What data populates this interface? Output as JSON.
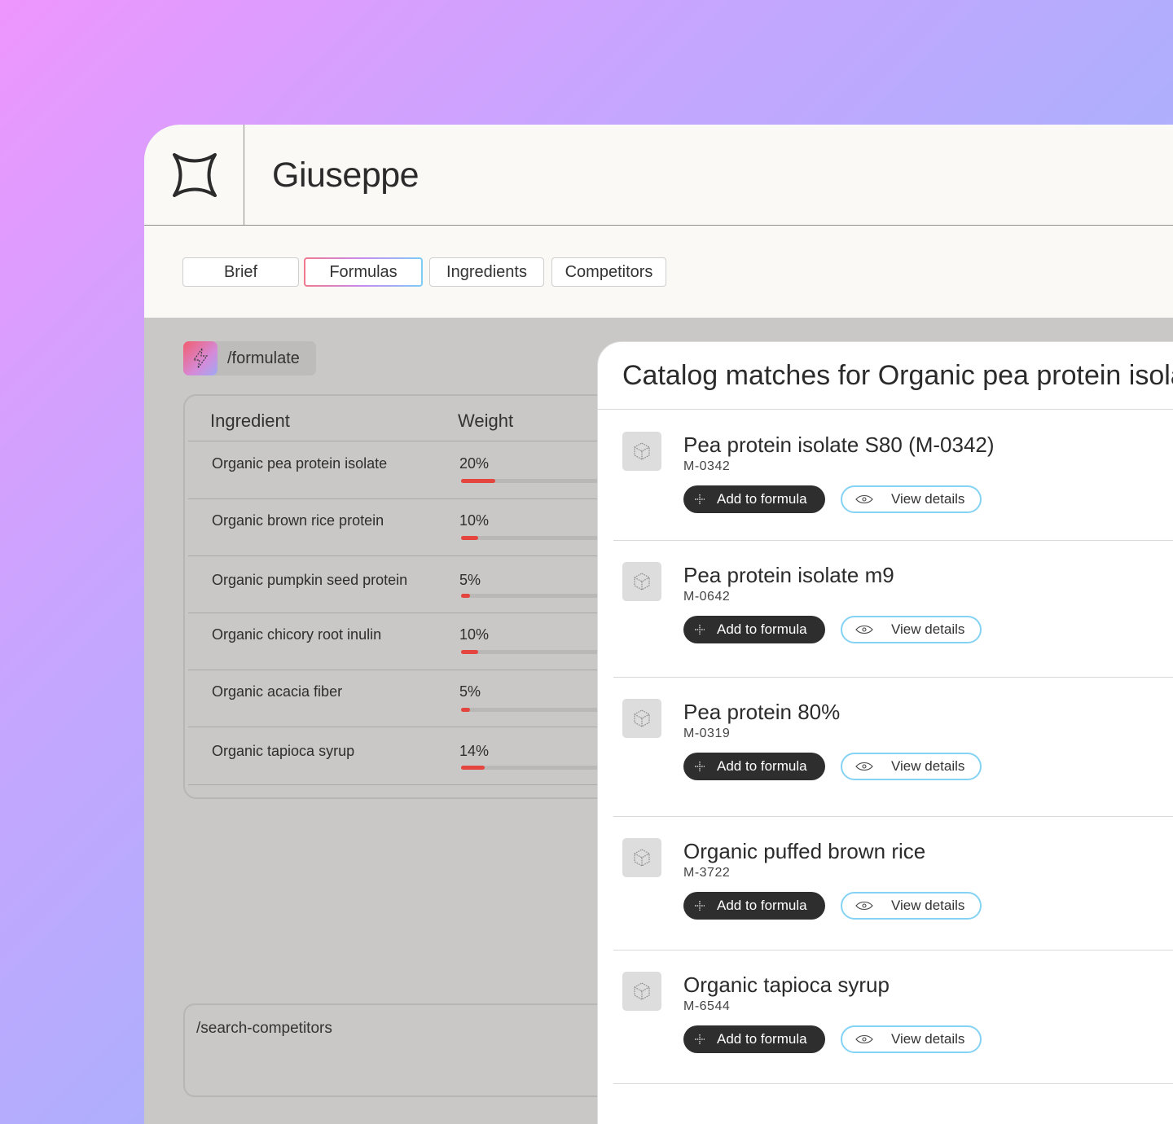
{
  "app": {
    "title": "Giuseppe"
  },
  "tabs": [
    {
      "label": "Brief",
      "active": false
    },
    {
      "label": "Formulas",
      "active": true
    },
    {
      "label": "Ingredients",
      "active": false
    },
    {
      "label": "Competitors",
      "active": false
    }
  ],
  "command": {
    "label": "/formulate",
    "icon": "lightning-icon"
  },
  "table": {
    "headers": {
      "ingredient": "Ingredient",
      "weight": "Weight"
    },
    "rows": [
      {
        "ingredient": "Organic pea protein isolate",
        "weight": "20%",
        "level": 20
      },
      {
        "ingredient": "Organic brown rice protein",
        "weight": "10%",
        "level": 10
      },
      {
        "ingredient": "Organic pumpkin seed protein",
        "weight": "5%",
        "level": 5
      },
      {
        "ingredient": "Organic chicory root inulin",
        "weight": "10%",
        "level": 10
      },
      {
        "ingredient": "Organic acacia fiber",
        "weight": "5%",
        "level": 5
      },
      {
        "ingredient": "Organic tapioca syrup",
        "weight": "14%",
        "level": 14
      }
    ]
  },
  "search": {
    "text": "/search-competitors"
  },
  "panel": {
    "title": "Catalog matches for Organic pea protein isolate",
    "add_label": "Add to formula",
    "view_label": "View details",
    "matches": [
      {
        "name": "Pea protein isolate S80  (M-0342)",
        "code": "M-0342"
      },
      {
        "name": "Pea protein isolate m9",
        "code": "M-0642"
      },
      {
        "name": "Pea protein 80%",
        "code": "M-0319"
      },
      {
        "name": "Organic puffed brown rice",
        "code": "M-3722"
      },
      {
        "name": "Organic tapioca syrup",
        "code": "M-6544"
      }
    ]
  },
  "colors": {
    "accent_red": "#e4463f",
    "dark_button": "#2e2e2e",
    "outline_blue": "#85d3f4"
  }
}
